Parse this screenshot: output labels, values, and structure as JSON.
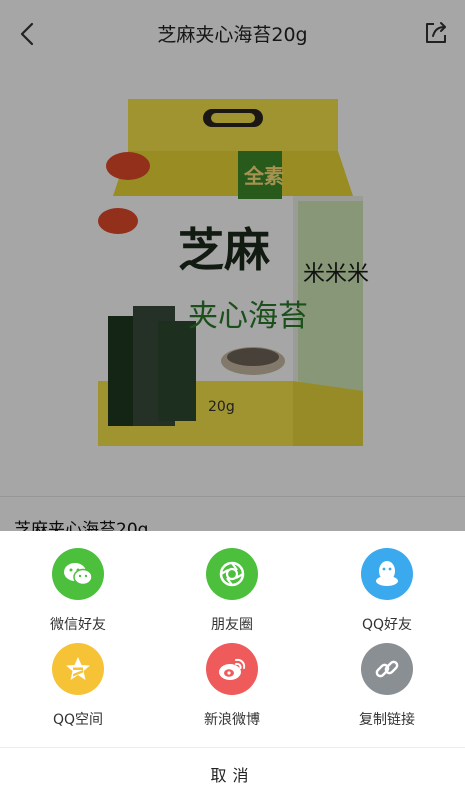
{
  "header": {
    "title": "芝麻夹心海苔20g"
  },
  "product": {
    "name": "芝麻夹心海苔20g",
    "package_brand": "全素",
    "package_title_1": "芝麻",
    "package_title_2": "夹心海苔",
    "package_weight": "20g"
  },
  "share_sheet": {
    "options": [
      {
        "label": "微信好友",
        "icon": "wechat-icon",
        "color": "#4cbf3c"
      },
      {
        "label": "朋友圈",
        "icon": "moments-icon",
        "color": "#4cbf3c"
      },
      {
        "label": "QQ好友",
        "icon": "qq-icon",
        "color": "#3aa9ee"
      },
      {
        "label": "QQ空间",
        "icon": "qzone-icon",
        "color": "#f6c236"
      },
      {
        "label": "新浪微博",
        "icon": "weibo-icon",
        "color": "#ef5b5b"
      },
      {
        "label": "复制链接",
        "icon": "link-icon",
        "color": "#8a8f94"
      }
    ],
    "cancel_label": "取消"
  }
}
